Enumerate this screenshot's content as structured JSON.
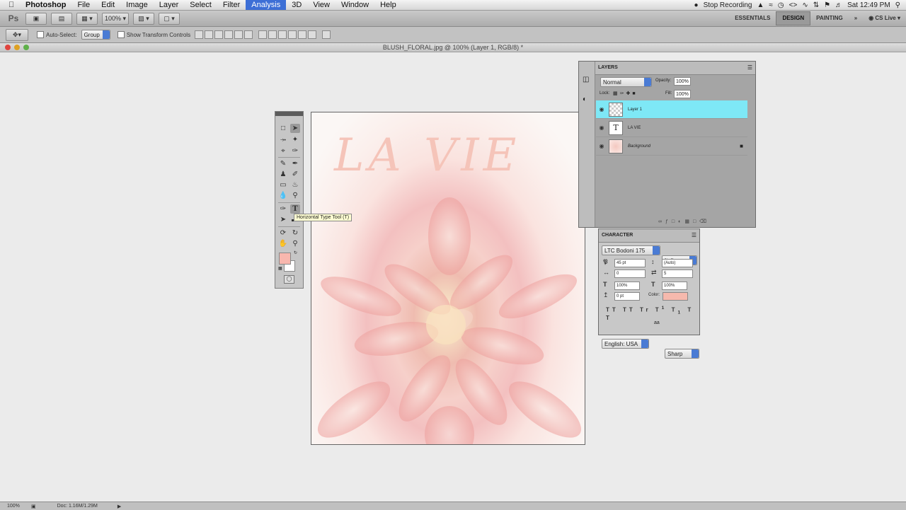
{
  "menubar": {
    "app_name": "Photoshop",
    "items": [
      "File",
      "Edit",
      "Image",
      "Layer",
      "Select",
      "Filter",
      "Analysis",
      "3D",
      "View",
      "Window",
      "Help"
    ],
    "active_item": "Analysis",
    "stop_recording": "Stop Recording",
    "clock": "Sat 12:49 PM"
  },
  "appbar": {
    "logo": "Ps",
    "zoom": "100%",
    "workspaces": [
      "ESSENTIALS",
      "DESIGN",
      "PAINTING"
    ],
    "active_workspace": "DESIGN",
    "more": "»",
    "cs_live": "CS Live"
  },
  "options": {
    "auto_select": "Auto-Select:",
    "auto_select_value": "Group",
    "show_transform": "Show Transform Controls"
  },
  "document": {
    "title": "BLUSH_FLORAL.jpg @ 100% (Layer 1, RGB/8) *",
    "overlay_text": "LA VIE"
  },
  "tooltip": "Horizontal Type Tool (T)",
  "layers_panel": {
    "tab": "LAYERS",
    "blend_mode": "Normal",
    "opacity_label": "Opacity:",
    "opacity": "100%",
    "lock_label": "Lock:",
    "fill_label": "Fill:",
    "fill": "100%",
    "layers": [
      {
        "name": "Layer 1",
        "selected": true
      },
      {
        "name": "LA VIE",
        "selected": false
      },
      {
        "name": "Background",
        "selected": false
      }
    ],
    "selected_color": "#7ee8f6"
  },
  "character_panel": {
    "tab": "CHARACTER",
    "font_family": "LTC Bodoni 175",
    "font_style": "Italic",
    "font_size": "45 pt",
    "leading": "(Auto)",
    "kerning": "0",
    "tracking": "5",
    "vertical_scale": "100%",
    "horizontal_scale": "100%",
    "baseline_shift": "0 pt",
    "color_label": "Color:",
    "color": "#f6b9ad",
    "language": "English: USA",
    "aa_label": "aa",
    "antialias": "Sharp"
  },
  "status": {
    "zoom": "100%",
    "doc": "Doc: 1.16M/1.29M"
  },
  "colors": {
    "foreground": "#f8b7ae",
    "background": "#ffffff"
  }
}
